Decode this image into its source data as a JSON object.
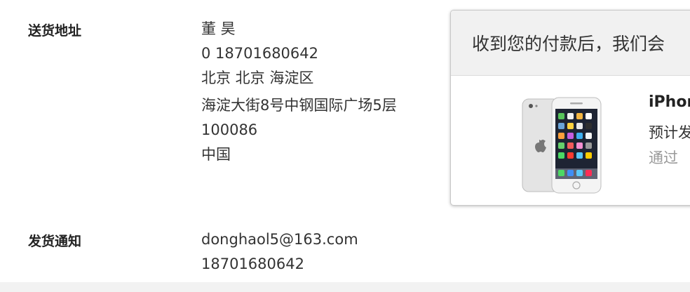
{
  "shipping": {
    "label": "送货地址",
    "name": "董 昊",
    "phone": "0 18701680642",
    "region": "北京 北京 海淀区",
    "street": "海淀大街8号中钢国际广场5层",
    "postal_code": "100086",
    "country": "中国"
  },
  "notification": {
    "label": "发货通知",
    "email": "donghaol5@163.com",
    "phone": "18701680642"
  },
  "order_card": {
    "header": "收到您的付款后，我们会",
    "product_name": "iPhon",
    "ship_estimate": "预计发",
    "ship_method": "通过 "
  }
}
